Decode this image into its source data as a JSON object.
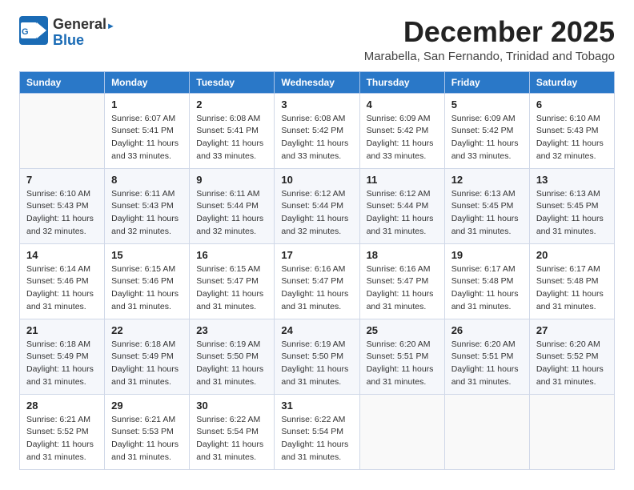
{
  "logo": {
    "general": "General",
    "blue": "Blue"
  },
  "title": "December 2025",
  "subtitle": "Marabella, San Fernando, Trinidad and Tobago",
  "weekdays": [
    "Sunday",
    "Monday",
    "Tuesday",
    "Wednesday",
    "Thursday",
    "Friday",
    "Saturday"
  ],
  "weeks": [
    [
      {
        "day": "",
        "sunrise": "",
        "sunset": "",
        "daylight": ""
      },
      {
        "day": "1",
        "sunrise": "Sunrise: 6:07 AM",
        "sunset": "Sunset: 5:41 PM",
        "daylight": "Daylight: 11 hours and 33 minutes."
      },
      {
        "day": "2",
        "sunrise": "Sunrise: 6:08 AM",
        "sunset": "Sunset: 5:41 PM",
        "daylight": "Daylight: 11 hours and 33 minutes."
      },
      {
        "day": "3",
        "sunrise": "Sunrise: 6:08 AM",
        "sunset": "Sunset: 5:42 PM",
        "daylight": "Daylight: 11 hours and 33 minutes."
      },
      {
        "day": "4",
        "sunrise": "Sunrise: 6:09 AM",
        "sunset": "Sunset: 5:42 PM",
        "daylight": "Daylight: 11 hours and 33 minutes."
      },
      {
        "day": "5",
        "sunrise": "Sunrise: 6:09 AM",
        "sunset": "Sunset: 5:42 PM",
        "daylight": "Daylight: 11 hours and 33 minutes."
      },
      {
        "day": "6",
        "sunrise": "Sunrise: 6:10 AM",
        "sunset": "Sunset: 5:43 PM",
        "daylight": "Daylight: 11 hours and 32 minutes."
      }
    ],
    [
      {
        "day": "7",
        "sunrise": "Sunrise: 6:10 AM",
        "sunset": "Sunset: 5:43 PM",
        "daylight": "Daylight: 11 hours and 32 minutes."
      },
      {
        "day": "8",
        "sunrise": "Sunrise: 6:11 AM",
        "sunset": "Sunset: 5:43 PM",
        "daylight": "Daylight: 11 hours and 32 minutes."
      },
      {
        "day": "9",
        "sunrise": "Sunrise: 6:11 AM",
        "sunset": "Sunset: 5:44 PM",
        "daylight": "Daylight: 11 hours and 32 minutes."
      },
      {
        "day": "10",
        "sunrise": "Sunrise: 6:12 AM",
        "sunset": "Sunset: 5:44 PM",
        "daylight": "Daylight: 11 hours and 32 minutes."
      },
      {
        "day": "11",
        "sunrise": "Sunrise: 6:12 AM",
        "sunset": "Sunset: 5:44 PM",
        "daylight": "Daylight: 11 hours and 31 minutes."
      },
      {
        "day": "12",
        "sunrise": "Sunrise: 6:13 AM",
        "sunset": "Sunset: 5:45 PM",
        "daylight": "Daylight: 11 hours and 31 minutes."
      },
      {
        "day": "13",
        "sunrise": "Sunrise: 6:13 AM",
        "sunset": "Sunset: 5:45 PM",
        "daylight": "Daylight: 11 hours and 31 minutes."
      }
    ],
    [
      {
        "day": "14",
        "sunrise": "Sunrise: 6:14 AM",
        "sunset": "Sunset: 5:46 PM",
        "daylight": "Daylight: 11 hours and 31 minutes."
      },
      {
        "day": "15",
        "sunrise": "Sunrise: 6:15 AM",
        "sunset": "Sunset: 5:46 PM",
        "daylight": "Daylight: 11 hours and 31 minutes."
      },
      {
        "day": "16",
        "sunrise": "Sunrise: 6:15 AM",
        "sunset": "Sunset: 5:47 PM",
        "daylight": "Daylight: 11 hours and 31 minutes."
      },
      {
        "day": "17",
        "sunrise": "Sunrise: 6:16 AM",
        "sunset": "Sunset: 5:47 PM",
        "daylight": "Daylight: 11 hours and 31 minutes."
      },
      {
        "day": "18",
        "sunrise": "Sunrise: 6:16 AM",
        "sunset": "Sunset: 5:47 PM",
        "daylight": "Daylight: 11 hours and 31 minutes."
      },
      {
        "day": "19",
        "sunrise": "Sunrise: 6:17 AM",
        "sunset": "Sunset: 5:48 PM",
        "daylight": "Daylight: 11 hours and 31 minutes."
      },
      {
        "day": "20",
        "sunrise": "Sunrise: 6:17 AM",
        "sunset": "Sunset: 5:48 PM",
        "daylight": "Daylight: 11 hours and 31 minutes."
      }
    ],
    [
      {
        "day": "21",
        "sunrise": "Sunrise: 6:18 AM",
        "sunset": "Sunset: 5:49 PM",
        "daylight": "Daylight: 11 hours and 31 minutes."
      },
      {
        "day": "22",
        "sunrise": "Sunrise: 6:18 AM",
        "sunset": "Sunset: 5:49 PM",
        "daylight": "Daylight: 11 hours and 31 minutes."
      },
      {
        "day": "23",
        "sunrise": "Sunrise: 6:19 AM",
        "sunset": "Sunset: 5:50 PM",
        "daylight": "Daylight: 11 hours and 31 minutes."
      },
      {
        "day": "24",
        "sunrise": "Sunrise: 6:19 AM",
        "sunset": "Sunset: 5:50 PM",
        "daylight": "Daylight: 11 hours and 31 minutes."
      },
      {
        "day": "25",
        "sunrise": "Sunrise: 6:20 AM",
        "sunset": "Sunset: 5:51 PM",
        "daylight": "Daylight: 11 hours and 31 minutes."
      },
      {
        "day": "26",
        "sunrise": "Sunrise: 6:20 AM",
        "sunset": "Sunset: 5:51 PM",
        "daylight": "Daylight: 11 hours and 31 minutes."
      },
      {
        "day": "27",
        "sunrise": "Sunrise: 6:20 AM",
        "sunset": "Sunset: 5:52 PM",
        "daylight": "Daylight: 11 hours and 31 minutes."
      }
    ],
    [
      {
        "day": "28",
        "sunrise": "Sunrise: 6:21 AM",
        "sunset": "Sunset: 5:52 PM",
        "daylight": "Daylight: 11 hours and 31 minutes."
      },
      {
        "day": "29",
        "sunrise": "Sunrise: 6:21 AM",
        "sunset": "Sunset: 5:53 PM",
        "daylight": "Daylight: 11 hours and 31 minutes."
      },
      {
        "day": "30",
        "sunrise": "Sunrise: 6:22 AM",
        "sunset": "Sunset: 5:54 PM",
        "daylight": "Daylight: 11 hours and 31 minutes."
      },
      {
        "day": "31",
        "sunrise": "Sunrise: 6:22 AM",
        "sunset": "Sunset: 5:54 PM",
        "daylight": "Daylight: 11 hours and 31 minutes."
      },
      {
        "day": "",
        "sunrise": "",
        "sunset": "",
        "daylight": ""
      },
      {
        "day": "",
        "sunrise": "",
        "sunset": "",
        "daylight": ""
      },
      {
        "day": "",
        "sunrise": "",
        "sunset": "",
        "daylight": ""
      }
    ]
  ]
}
